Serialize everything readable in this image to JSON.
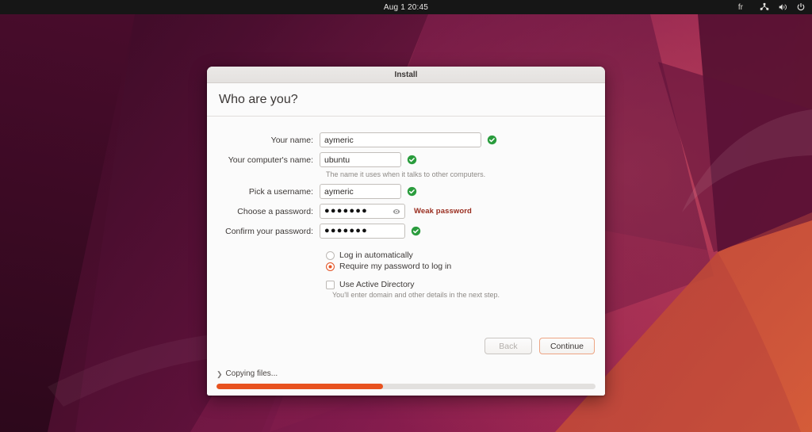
{
  "topbar": {
    "clock": "Aug 1  20:45",
    "keyboard_layout": "fr",
    "icons": [
      "network-icon",
      "volume-icon",
      "power-icon"
    ]
  },
  "window": {
    "title": "Install",
    "page_title": "Who are you?"
  },
  "form": {
    "fields": [
      {
        "label": "Your name:",
        "value": "aymeric",
        "valid": true
      },
      {
        "label": "Your computer's name:",
        "value": "ubuntu",
        "valid": true
      },
      {
        "label": "Pick a username:",
        "value": "aymeric",
        "valid": true
      },
      {
        "label": "Choose a password:",
        "value": "●●●●●●●",
        "valid": false
      },
      {
        "label": "Confirm your password:",
        "value": "●●●●●●●",
        "valid": true
      }
    ],
    "computer_name_hint": "The name it uses when it talks to other computers.",
    "password_strength": "Weak password",
    "login_options": [
      {
        "label": "Log in automatically",
        "selected": false
      },
      {
        "label": "Require my password to log in",
        "selected": true
      }
    ],
    "active_directory": {
      "label": "Use Active Directory",
      "checked": false,
      "hint": "You'll enter domain and other details in the next step."
    }
  },
  "buttons": {
    "back": "Back",
    "continue": "Continue"
  },
  "progress": {
    "status": "Copying files...",
    "percent": 44
  },
  "colors": {
    "accent": "#e95420",
    "progress_fill": "#e8521f",
    "valid_green": "#2a9c3d",
    "weak_red": "#992c1e"
  }
}
